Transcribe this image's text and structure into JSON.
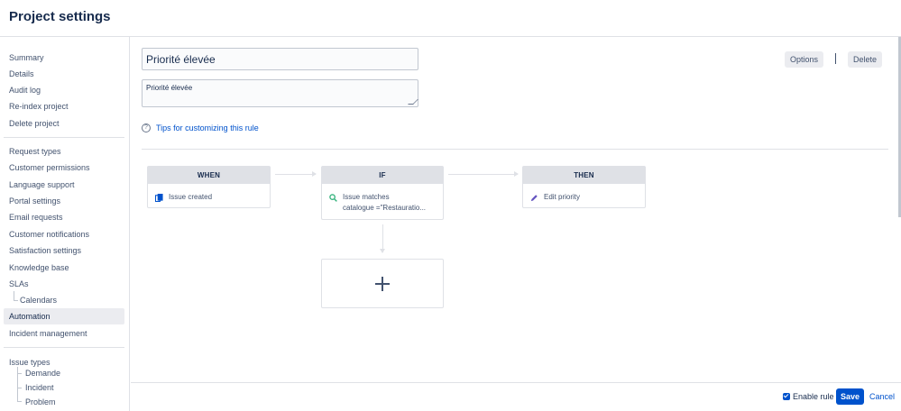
{
  "header": {
    "title": "Project settings"
  },
  "sidebar": {
    "group1": [
      "Summary",
      "Details",
      "Audit log",
      "Re-index project",
      "Delete project"
    ],
    "group2": [
      "Request types",
      "Customer permissions",
      "Language support",
      "Portal settings",
      "Email requests",
      "Customer notifications",
      "Satisfaction settings",
      "Knowledge base",
      "SLAs"
    ],
    "slas_child": "Calendars",
    "active": "Automation",
    "incident": "Incident management",
    "issue_types": {
      "label": "Issue types",
      "children": [
        "Demande",
        "Incident",
        "Problem"
      ]
    }
  },
  "rule": {
    "name": "Priorité élevée",
    "description": "Priorité élevée",
    "tips_label": "Tips for customizing this rule",
    "options_label": "Options",
    "delete_label": "Delete"
  },
  "flow": {
    "when": {
      "heading": "WHEN",
      "text": "Issue created",
      "icon": "copy-icon"
    },
    "if": {
      "heading": "IF",
      "text_line1": "Issue matches",
      "text_line2": "catalogue =\"Restauratio...",
      "icon": "search-icon"
    },
    "then": {
      "heading": "THEN",
      "text": "Edit priority",
      "icon": "pencil-icon"
    }
  },
  "footer": {
    "enable_label": "Enable rule",
    "enable_checked": true,
    "save_label": "Save",
    "cancel_label": "Cancel"
  },
  "colors": {
    "primary": "#0052cc",
    "text": "#172b4d",
    "muted": "#42526e",
    "border": "#dfe1e6"
  }
}
